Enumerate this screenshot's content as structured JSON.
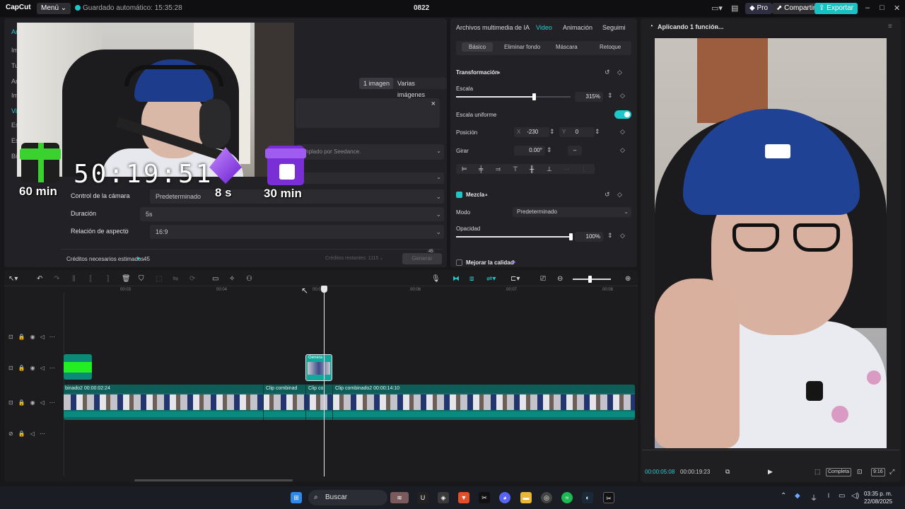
{
  "titlebar": {
    "logo": "CapCut",
    "menu": "Menú",
    "autosave": "Guardado automático: 15:35:28",
    "project": "0822",
    "pro": "Pro",
    "share": "Compartir",
    "export": "Exportar"
  },
  "left_panel": {
    "side_tabs": [
      "Arch",
      "Im",
      "Tu",
      "Ar",
      "Im",
      "Vi",
      "Es",
      "Es",
      "Bi"
    ],
    "chips": [
      "1 imagen",
      "Varias imágenes"
    ],
    "close": "×",
    "model_hint": "nplado por Seedance.",
    "fields": [
      {
        "label": "Control de la cámara",
        "value": "Predeterminado"
      },
      {
        "label": "Duración",
        "value": "5s"
      },
      {
        "label": "Relación de aspecto",
        "value": "16:9"
      }
    ],
    "credits_label": "Créditos necesarios estimados",
    "credits_value": "45",
    "credits_remaining": "Créditos restantes: 1115",
    "generate": "Generar",
    "generate_badge": "45"
  },
  "overlay": {
    "timer": "50:19:51",
    "gift_left": "60 min",
    "gift_mid": "8 s",
    "gift_right": "30 min"
  },
  "props": {
    "tabs": [
      "Archivos multimedia de IA",
      "Video",
      "Animación",
      "Seguimi"
    ],
    "active_tab": "Video",
    "subtabs": [
      "Básico",
      "Eliminar fondo",
      "Máscara",
      "Retoque"
    ],
    "transform": "Transformación",
    "scale_label": "Escala",
    "scale_value": "315%",
    "scale_fraction": 0.68,
    "uniform_label": "Escala uniforme",
    "position_label": "Posición",
    "pos_x_label": "X",
    "pos_x": "-230",
    "pos_y_label": "Y",
    "pos_y": "0",
    "rotate_label": "Girar",
    "rotate_value": "0.00°",
    "blend": "Mezcla",
    "mode_label": "Modo",
    "mode_value": "Predeterminado",
    "opacity_label": "Opacidad",
    "opacity_value": "100%",
    "opacity_fraction": 1.0,
    "enhance": "Mejorar la calidad"
  },
  "preview": {
    "title": "Aplicando 1 función...",
    "current_time": "00:00:05:08",
    "total_time": "00:00:19:23",
    "full": "Completa",
    "ratio": "9:16"
  },
  "timeline": {
    "ruler": [
      "00:03",
      "00:04",
      "00:05",
      "00:06",
      "00:07",
      "00:08"
    ],
    "clip_ai_label": "Genera",
    "main_labels": [
      {
        "text": "binado2  00:00:02:24"
      },
      {
        "text": "Clip combinad"
      },
      {
        "text": "Clip co"
      },
      {
        "text": "Clip combinado2  00:00:14:10"
      }
    ]
  },
  "taskbar": {
    "search": "Buscar",
    "time": "03:35 p. m.",
    "date": "22/08/2025"
  },
  "colors": {
    "accent": "#1fc6c6",
    "panel": "#222226",
    "background": "#18181a"
  }
}
